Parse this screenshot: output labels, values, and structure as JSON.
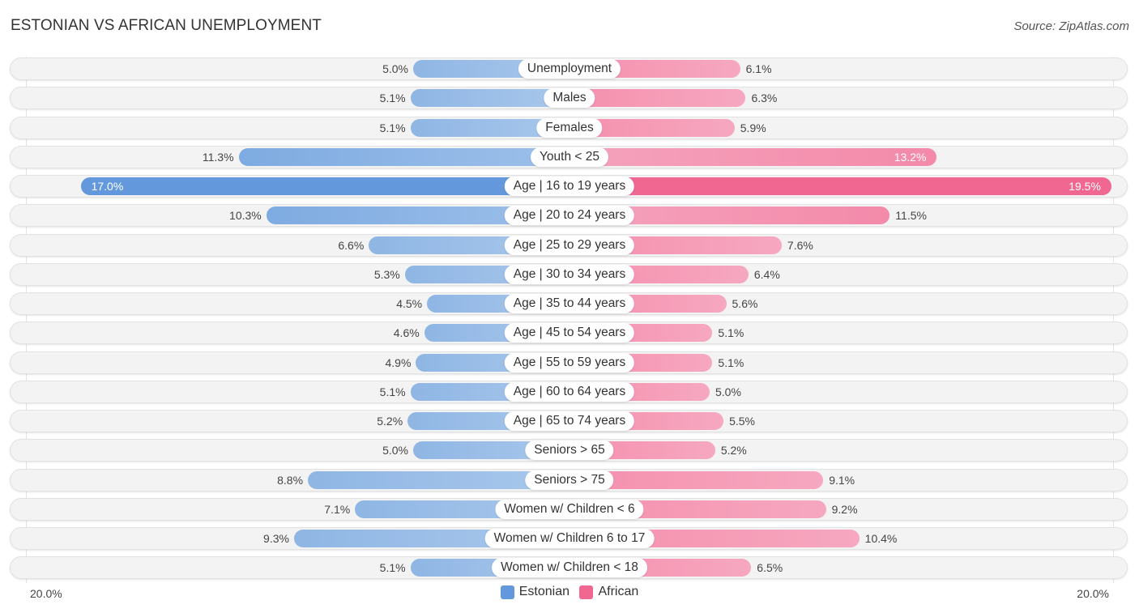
{
  "title": "ESTONIAN VS AFRICAN UNEMPLOYMENT",
  "source": "Source: ZipAtlas.com",
  "colors": {
    "estonian": "#6399dc",
    "african": "#f06892"
  },
  "chart_data": {
    "type": "bar",
    "orientation": "horizontal-diverging",
    "title": "ESTONIAN VS AFRICAN UNEMPLOYMENT",
    "xlabel": "",
    "ylabel": "",
    "xlim": [
      -20,
      20
    ],
    "axis_labels": {
      "left": "20.0%",
      "right": "20.0%"
    },
    "legend": {
      "position": "bottom-center",
      "entries": [
        "Estonian",
        "African"
      ]
    },
    "categories": [
      "Unemployment",
      "Males",
      "Females",
      "Youth < 25",
      "Age | 16 to 19 years",
      "Age | 20 to 24 years",
      "Age | 25 to 29 years",
      "Age | 30 to 34 years",
      "Age | 35 to 44 years",
      "Age | 45 to 54 years",
      "Age | 55 to 59 years",
      "Age | 60 to 64 years",
      "Age | 65 to 74 years",
      "Seniors > 65",
      "Seniors > 75",
      "Women w/ Children < 6",
      "Women w/ Children 6 to 17",
      "Women w/ Children < 18"
    ],
    "series": [
      {
        "name": "Estonian",
        "side": "left",
        "values": [
          5.0,
          5.1,
          5.1,
          11.3,
          17.0,
          10.3,
          6.6,
          5.3,
          4.5,
          4.6,
          4.9,
          5.1,
          5.2,
          5.0,
          8.8,
          7.1,
          9.3,
          5.1
        ],
        "labels": [
          "5.0%",
          "5.1%",
          "5.1%",
          "11.3%",
          "17.0%",
          "10.3%",
          "6.6%",
          "5.3%",
          "4.5%",
          "4.6%",
          "4.9%",
          "5.1%",
          "5.2%",
          "5.0%",
          "8.8%",
          "7.1%",
          "9.3%",
          "5.1%"
        ]
      },
      {
        "name": "African",
        "side": "right",
        "values": [
          6.1,
          6.3,
          5.9,
          13.2,
          19.5,
          11.5,
          7.6,
          6.4,
          5.6,
          5.1,
          5.1,
          5.0,
          5.5,
          5.2,
          9.1,
          9.2,
          10.4,
          6.5
        ],
        "labels": [
          "6.1%",
          "6.3%",
          "5.9%",
          "13.2%",
          "19.5%",
          "11.5%",
          "7.6%",
          "6.4%",
          "5.6%",
          "5.1%",
          "5.1%",
          "5.0%",
          "5.5%",
          "5.2%",
          "9.1%",
          "9.2%",
          "10.4%",
          "6.5%"
        ]
      }
    ]
  }
}
